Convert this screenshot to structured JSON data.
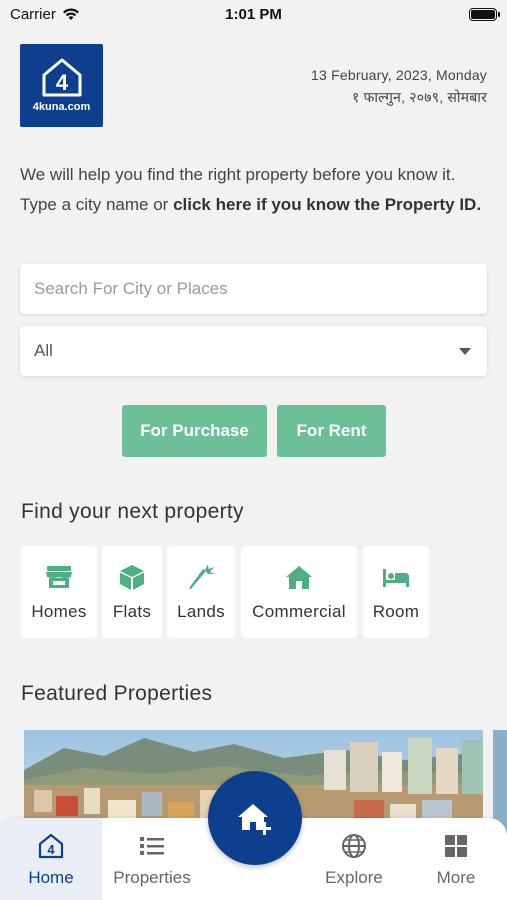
{
  "status_bar": {
    "carrier": "Carrier",
    "time": "1:01 PM"
  },
  "header": {
    "logo_text": "4kuna.com",
    "date_english": "13 February, 2023, Monday",
    "date_nepali": "१ फाल्गुन, २०७९, सोमबार"
  },
  "intro": {
    "text": "We will help you find the right property before you know it. Type a city name or",
    "link": "click here if you know the Property ID."
  },
  "search": {
    "placeholder": "Search For City or Places",
    "value": ""
  },
  "filter": {
    "selected": "All"
  },
  "buttons": {
    "purchase": "For Purchase",
    "rent": "For Rent"
  },
  "find_section": {
    "title": "Find your next property",
    "categories": [
      {
        "label": "Homes",
        "icon": "store-icon"
      },
      {
        "label": "Flats",
        "icon": "box-icon"
      },
      {
        "label": "Lands",
        "icon": "carrot-icon"
      },
      {
        "label": "Commercial",
        "icon": "house-icon"
      },
      {
        "label": "Room",
        "icon": "bed-icon"
      }
    ]
  },
  "featured": {
    "title": "Featured Properties"
  },
  "bottom_nav": {
    "items": [
      {
        "label": "Home",
        "icon": "home-logo-icon"
      },
      {
        "label": "Properties",
        "icon": "list-icon"
      },
      {
        "label": "Explore",
        "icon": "globe-icon"
      },
      {
        "label": "More",
        "icon": "grid-icon"
      }
    ],
    "fab_icon": "add-home-icon"
  },
  "colors": {
    "brand": "#0e3f8f",
    "accent": "#6cbf96",
    "category_icon": "#4fae82"
  }
}
